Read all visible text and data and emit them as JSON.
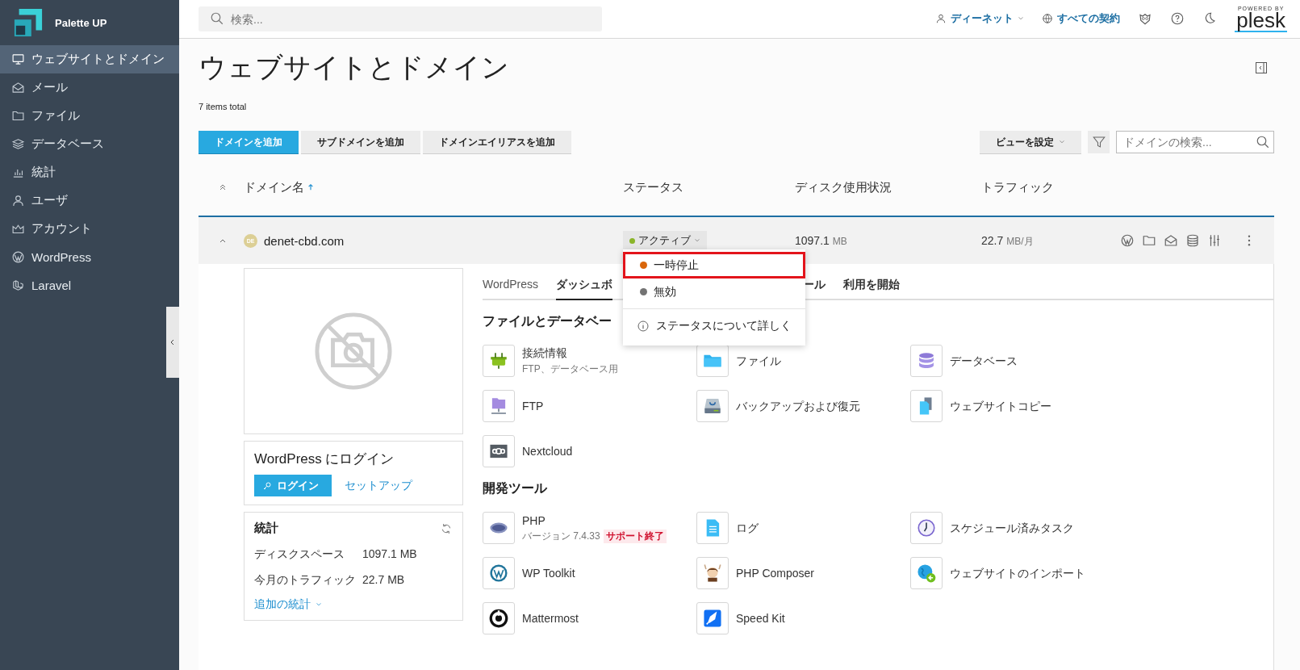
{
  "brand": {
    "name": "Palette UP"
  },
  "sidebar": {
    "items": [
      {
        "label": "ウェブサイトとドメイン",
        "selected": true
      },
      {
        "label": "メール",
        "selected": false
      },
      {
        "label": "ファイル",
        "selected": false
      },
      {
        "label": "データベース",
        "selected": false
      },
      {
        "label": "統計",
        "selected": false
      },
      {
        "label": "ユーザ",
        "selected": false
      },
      {
        "label": "アカウント",
        "selected": false
      },
      {
        "label": "WordPress",
        "selected": false
      },
      {
        "label": "Laravel",
        "selected": false
      }
    ]
  },
  "header": {
    "search": {
      "placeholder": "検索..."
    },
    "user": "ディーネット",
    "subscriptions": "すべての契約",
    "powered_by": "POWERED BY",
    "product": "plesk"
  },
  "page": {
    "title": "ウェブサイトとドメイン",
    "items_total": "7 items total"
  },
  "toolbar": {
    "buttons": [
      {
        "label": "ドメインを追加",
        "primary": true
      },
      {
        "label": "サブドメインを追加",
        "primary": false
      },
      {
        "label": "ドメインエイリアスを追加",
        "primary": false
      }
    ],
    "view_button": "ビューを設定",
    "search": {
      "placeholder": "ドメインの検索..."
    }
  },
  "table": {
    "columns": [
      {
        "label": "ドメイン名",
        "sorted": true
      },
      {
        "label": "ステータス",
        "sorted": false
      },
      {
        "label": "ディスク使用状況",
        "sorted": false
      },
      {
        "label": "トラフィック",
        "sorted": false
      }
    ],
    "row": {
      "domain": "denet-cbd.com",
      "avatar": "DE",
      "status": {
        "label": "アクティブ",
        "color": "#8ab529"
      },
      "disk": {
        "value": "1097.1",
        "unit": "MB"
      },
      "traffic": {
        "value": "22.7",
        "unit": "MB/月"
      },
      "expanded": true
    }
  },
  "status_menu": {
    "items": [
      {
        "label": "一時停止",
        "color": "#d9660b",
        "selected": true
      },
      {
        "label": "無効",
        "color": "#737373",
        "selected": false
      }
    ],
    "help": "ステータスについて詳しく"
  },
  "wp_login": {
    "title": "WordPress にログイン",
    "login_button": "ログイン",
    "setup_link": "セットアップ"
  },
  "stats": {
    "title": "統計",
    "rows": [
      {
        "label": "ディスクスペース",
        "value": "1097.1 MB"
      },
      {
        "label": "今月のトラフィック",
        "value": "22.7 MB"
      }
    ],
    "more_link": "追加の統計"
  },
  "tabs": [
    {
      "label": "WordPress",
      "selected": false
    },
    {
      "label": "ダッシュボ",
      "selected": true
    },
    {
      "label": "ール",
      "selected": false
    },
    {
      "label": "利用を開始",
      "selected": false
    }
  ],
  "sections": [
    {
      "title": "ファイルとデータベー",
      "tools": [
        {
          "name": "接続情報",
          "subtitle": "FTP、データベース用"
        },
        {
          "name": "ファイル"
        },
        {
          "name": "データベース"
        },
        {
          "name": "FTP"
        },
        {
          "name": "バックアップおよび復元"
        },
        {
          "name": "ウェブサイトコピー"
        },
        {
          "name": "Nextcloud"
        }
      ]
    },
    {
      "title": "開発ツール",
      "tools": [
        {
          "name": "PHP",
          "subtitle": "バージョン 7.4.33",
          "badge": "サポート終了"
        },
        {
          "name": "ログ"
        },
        {
          "name": "スケジュール済みタスク"
        },
        {
          "name": "WP Toolkit"
        },
        {
          "name": "PHP Composer"
        },
        {
          "name": "ウェブサイトのインポート"
        },
        {
          "name": "Mattermost"
        },
        {
          "name": "Speed Kit"
        }
      ]
    }
  ]
}
